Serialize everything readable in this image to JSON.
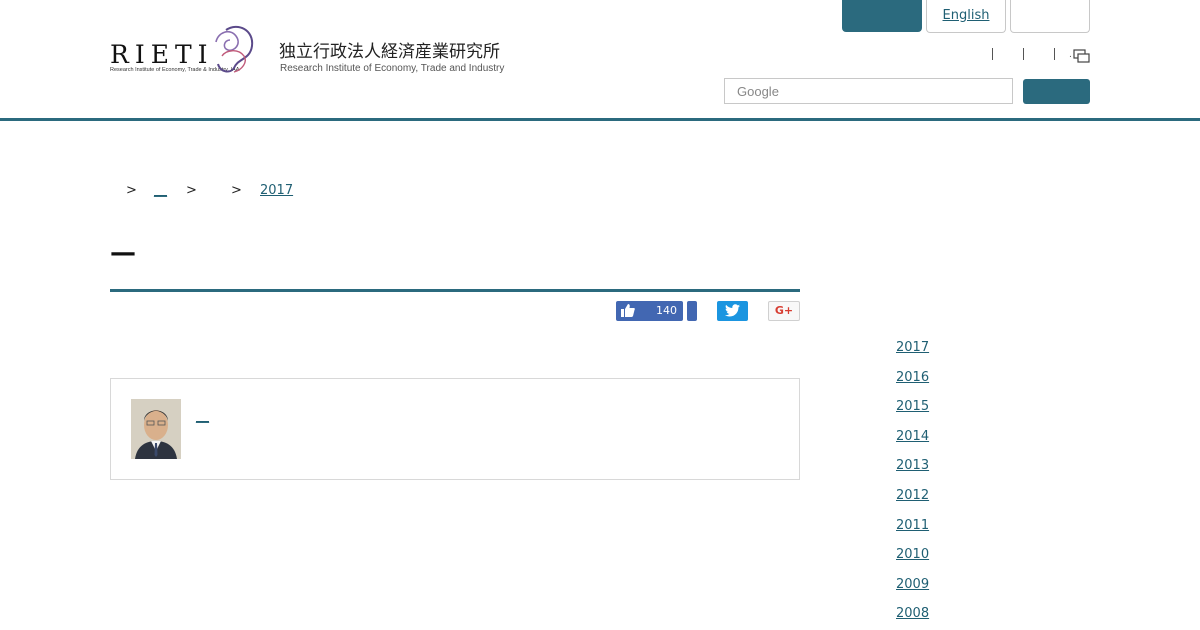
{
  "brand": {
    "logo_word": "RIETI",
    "logo_subtitle": "Research Institute of Economy, Trade & Industry, IAA",
    "org_name_ja": "独立行政法人経済産業研究所",
    "org_name_en": "Research Institute of Economy, Trade and Industry",
    "accent_color": "#2b6a7e"
  },
  "header": {
    "dark_button_label": "",
    "english_label": "English",
    "blank_button_label": "",
    "util_dot": ".",
    "util_icon": "window-icon"
  },
  "search": {
    "placeholder": "Google",
    "button_label": ""
  },
  "breadcrumb": {
    "sep": ">",
    "item1": "__",
    "item3": "2017"
  },
  "page": {
    "title": "—"
  },
  "social": {
    "like_count": "140",
    "google_plus_label": "G+",
    "facebook_color": "#4267b2",
    "twitter_color": "#1b95e0"
  },
  "author": {
    "name_link": "__"
  },
  "sidebar": {
    "years": [
      "2017",
      "2016",
      "2015",
      "2014",
      "2013",
      "2012",
      "2011",
      "2010",
      "2009",
      "2008"
    ]
  }
}
